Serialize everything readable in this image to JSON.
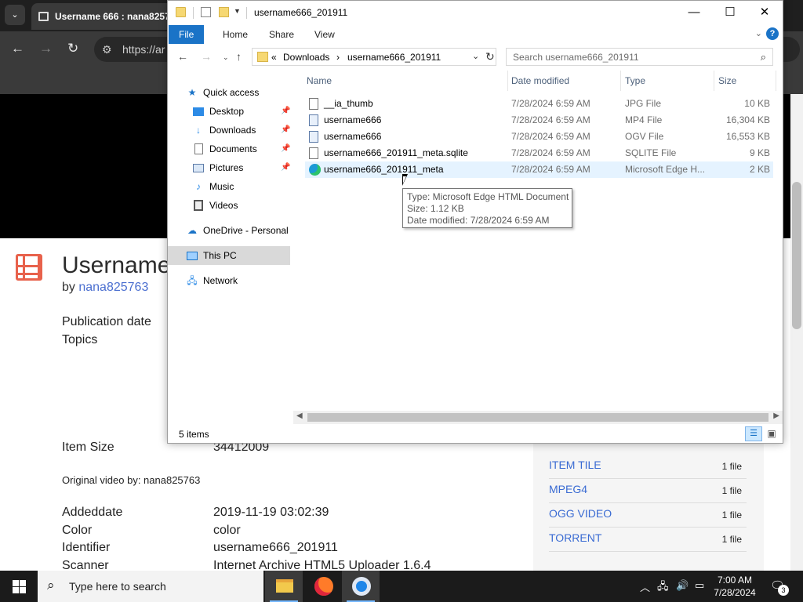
{
  "browser": {
    "tab_title": "Username 666 : nana8257",
    "url": "https://ar",
    "item_title": "Username",
    "by_prefix": "by",
    "uploader": "nana825763",
    "meta_keys": {
      "publication_date": "Publication date",
      "topics": "Topics",
      "item_size": "Item Size",
      "addeddate": "Addeddate",
      "color": "Color",
      "identifier": "Identifier",
      "scanner": "Scanner"
    },
    "meta_values": {
      "item_size": "34412009",
      "addeddate": "2019-11-19 03:02:39",
      "color": "color",
      "identifier": "username666_201911",
      "scanner": "Internet Archive HTML5 Uploader 1.6.4"
    },
    "original_video": "Original video by: nana825763",
    "downloads": [
      {
        "name": "ITEM TILE",
        "count": "1 file"
      },
      {
        "name": "MPEG4",
        "count": "1 file"
      },
      {
        "name": "OGG VIDEO",
        "count": "1 file"
      },
      {
        "name": "TORRENT",
        "count": "1 file"
      }
    ]
  },
  "explorer": {
    "title": "username666_201911",
    "ribbon_tabs": [
      "File",
      "Home",
      "Share",
      "View"
    ],
    "address": {
      "overflow": "«",
      "crumbs": [
        "Downloads",
        "username666_201911"
      ]
    },
    "search_placeholder": "Search username666_201911",
    "nav": {
      "quick_access": "Quick access",
      "desktop": "Desktop",
      "downloads": "Downloads",
      "documents": "Documents",
      "pictures": "Pictures",
      "music": "Music",
      "videos": "Videos",
      "onedrive": "OneDrive - Personal",
      "this_pc": "This PC",
      "network": "Network"
    },
    "columns": {
      "name": "Name",
      "date": "Date modified",
      "type": "Type",
      "size": "Size"
    },
    "files": [
      {
        "name": "__ia_thumb",
        "date": "7/28/2024 6:59 AM",
        "type": "JPG File",
        "size": "10 KB"
      },
      {
        "name": "username666",
        "date": "7/28/2024 6:59 AM",
        "type": "MP4 File",
        "size": "16,304 KB"
      },
      {
        "name": "username666",
        "date": "7/28/2024 6:59 AM",
        "type": "OGV File",
        "size": "16,553 KB"
      },
      {
        "name": "username666_201911_meta.sqlite",
        "date": "7/28/2024 6:59 AM",
        "type": "SQLITE File",
        "size": "9 KB"
      },
      {
        "name": "username666_201911_meta",
        "date": "7/28/2024 6:59 AM",
        "type": "Microsoft Edge H...",
        "size": "2 KB"
      }
    ],
    "tooltip": {
      "type": "Type: Microsoft Edge HTML Document",
      "size": "Size: 1.12 KB",
      "date": "Date modified: 7/28/2024 6:59 AM"
    },
    "status": "5 items"
  },
  "taskbar": {
    "search_text": "Type here to search",
    "time": "7:00 AM",
    "date": "7/28/2024",
    "notifications": "3"
  }
}
